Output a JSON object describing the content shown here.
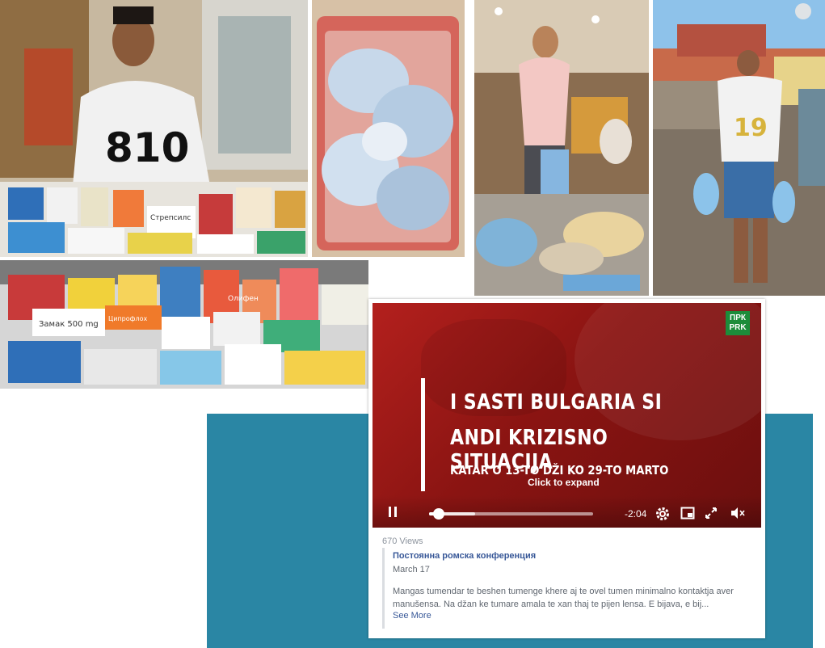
{
  "video": {
    "title_line1": "I SASTI BULGARIA SI",
    "title_line2": "ANDI KRIZISNO SITUACIJA",
    "subtitle": "KATAR O 13-TO DŽI KO 29-TO MARTO",
    "expand_label": "Click to expand",
    "logo_line1": "ПРК",
    "logo_line2": "PRK",
    "time_remaining": "-2:04",
    "progress_fraction": 0.06,
    "buffer_fraction": 0.28
  },
  "post": {
    "views": "670 Views",
    "page_name": "Постоянна ромска конференция",
    "date": "March 17",
    "text": "Mangas tumendar te beshen tumenge khere aj te ovel tumen minimalno kontaktja aver manušensa. Na džan ke tumare amala te xan thaj te pijen lensa. E bijava, e bij...",
    "see_more": "See More"
  },
  "photos": {
    "shirt_text_1": "810",
    "shirt_text_2": "19",
    "box_label_1": "Стрепсилс",
    "box_label_2": "Замак 500 mg",
    "box_label_3": "Ципрофлох",
    "box_label_4": "Олифен"
  },
  "colors": {
    "teal": "#2a86a4",
    "video_red": "#a11a18",
    "link_blue": "#385898"
  }
}
